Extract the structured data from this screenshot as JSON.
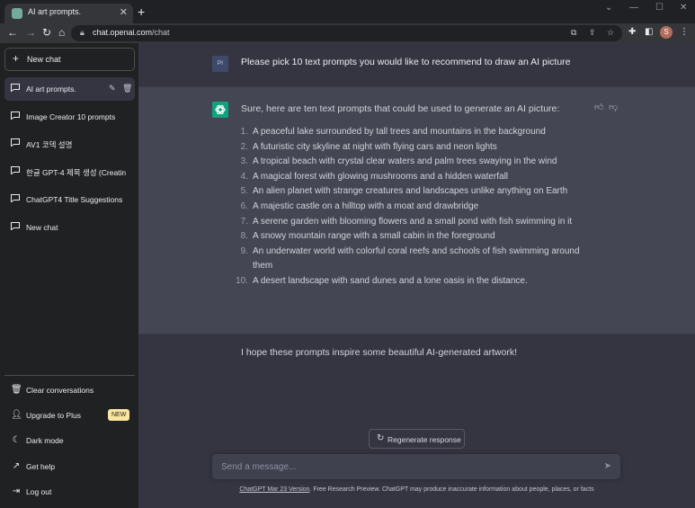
{
  "browser": {
    "tab_title": "AI art prompts.",
    "new_tab_label": "+",
    "url_host": "chat.openai.com",
    "url_path": "/chat",
    "profile_initial": "S"
  },
  "sidebar": {
    "new_chat": "New chat",
    "conversations": [
      {
        "label": "AI art prompts."
      },
      {
        "label": "Image Creator 10 prompts"
      },
      {
        "label": "AV1 코덱 설명"
      },
      {
        "label": "한글 GPT-4 제목 생성 (Creatin"
      },
      {
        "label": "ChatGPT4 Title Suggestions"
      },
      {
        "label": "New chat"
      }
    ],
    "bottom": {
      "clear": "Clear conversations",
      "upgrade": "Upgrade to Plus",
      "new_badge": "NEW",
      "dark_mode": "Dark mode",
      "help": "Get help",
      "logout": "Log out"
    }
  },
  "chat": {
    "user_avatar": "PI",
    "user_message": "Please pick 10 text prompts you would like to recommend to draw an AI picture",
    "assistant_intro": "Sure, here are ten text prompts that could be used to generate an AI picture:",
    "prompts": [
      {
        "num": "1.",
        "text": "A peaceful lake surrounded by tall trees and mountains in the background"
      },
      {
        "num": "2.",
        "text": "A futuristic city skyline at night with flying cars and neon lights"
      },
      {
        "num": "3.",
        "text": "A tropical beach with crystal clear waters and palm trees swaying in the wind"
      },
      {
        "num": "4.",
        "text": "A magical forest with glowing mushrooms and a hidden waterfall"
      },
      {
        "num": "5.",
        "text": "An alien planet with strange creatures and landscapes unlike anything on Earth"
      },
      {
        "num": "6.",
        "text": "A majestic castle on a hilltop with a moat and drawbridge"
      },
      {
        "num": "7.",
        "text": "A serene garden with blooming flowers and a small pond with fish swimming in it"
      },
      {
        "num": "8.",
        "text": "A snowy mountain range with a small cabin in the foreground"
      },
      {
        "num": "9.",
        "text": "An underwater world with colorful coral reefs and schools of fish swimming around them"
      },
      {
        "num": "10.",
        "text": "A desert landscape with sand dunes and a lone oasis in the distance."
      }
    ],
    "assistant_outro": "I hope these prompts inspire some beautiful AI-generated artwork!",
    "regenerate": "Regenerate response",
    "input_placeholder": "Send a message...",
    "footer_link": "ChatGPT Mar 23 Version",
    "footer_text": ". Free Research Preview. ChatGPT may produce inaccurate information about people, places, or facts"
  },
  "colors": {
    "sidebar_bg": "#202123",
    "main_bg": "#343541",
    "assistant_bg": "#444654",
    "brand_green": "#10a37f"
  }
}
